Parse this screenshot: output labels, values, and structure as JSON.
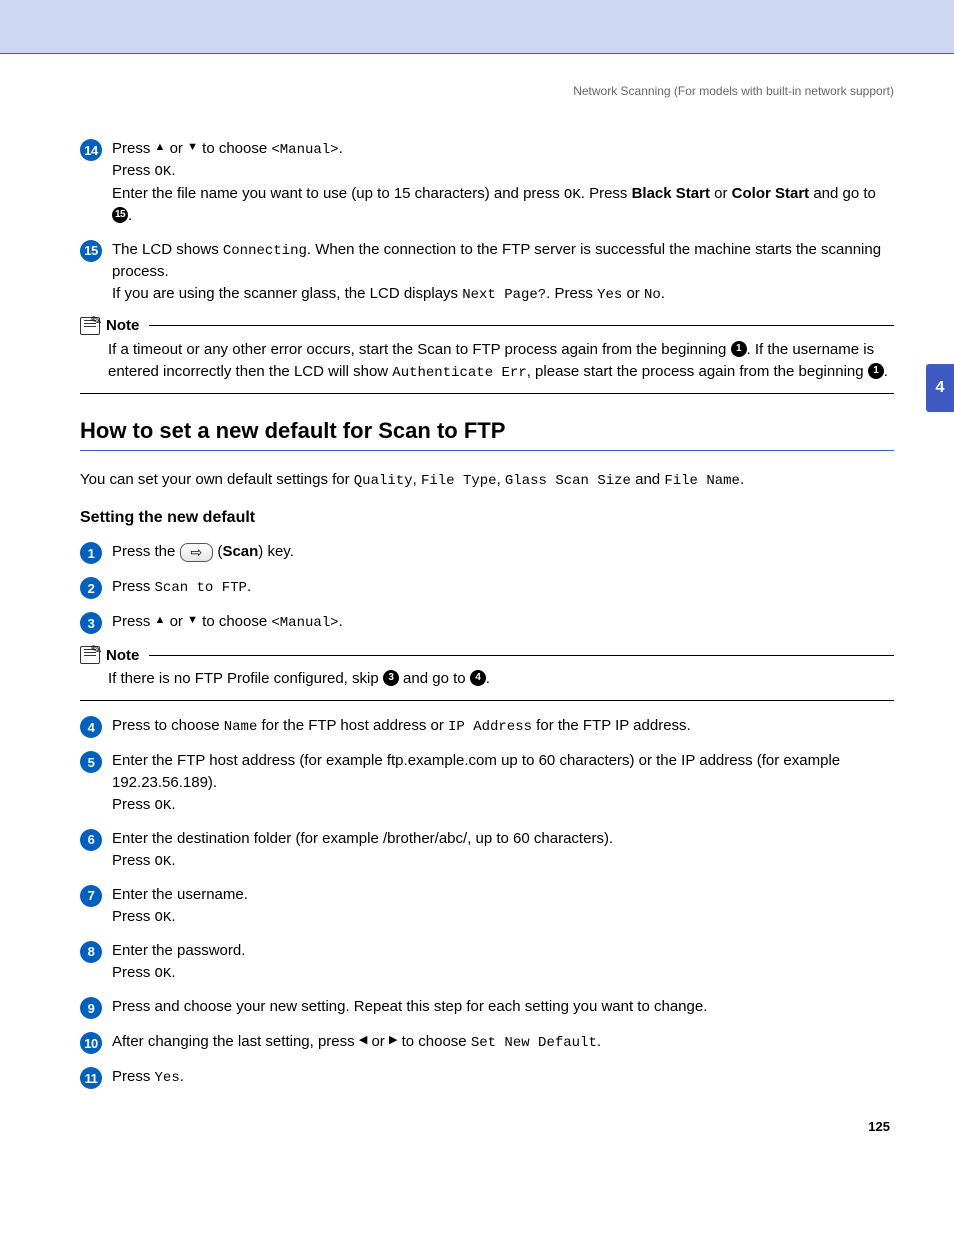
{
  "header": "Network Scanning  (For models with built-in network support)",
  "sideTab": "4",
  "pageNum": "125",
  "step14": {
    "num": "14",
    "l1a": "Press ",
    "l1b": " or ",
    "l1c": " to choose ",
    "l1d": "<Manual>",
    "l1e": ".",
    "l2a": "Press ",
    "l2b": "OK",
    "l2c": ".",
    "l3a": "Enter the file name you want to use (up to 15 characters) and press ",
    "l3b": "OK",
    "l3c": ". Press ",
    "l3d": "Black Start",
    "l3e": " or ",
    "l3f": "Color Start",
    "l3g": " and go to ",
    "l3h": "15",
    "l3i": "."
  },
  "step15": {
    "num": "15",
    "l1a": "The LCD shows ",
    "l1b": "Connecting",
    "l1c": ". When the connection to the FTP server is successful the machine starts the scanning process.",
    "l2a": "If you are using the scanner glass, the LCD displays ",
    "l2b": "Next Page?",
    "l2c": ". Press ",
    "l2d": "Yes",
    "l2e": " or ",
    "l2f": "No",
    "l2g": "."
  },
  "note1": {
    "label": "Note",
    "a": "If a timeout or any other error occurs, start the Scan to FTP process again from the beginning ",
    "b": "1",
    "c": ". If the username is entered incorrectly then the LCD will show ",
    "d": "Authenticate Err",
    "e": ", please start the process again from the beginning ",
    "f": "1",
    "g": "."
  },
  "h2": "How to set a new default for Scan to FTP",
  "intro": {
    "a": "You can set your own default settings for ",
    "b": "Quality",
    "c": ", ",
    "d": "File Type",
    "e": ", ",
    "f": "Glass Scan Size",
    "g": " and ",
    "h": "File Name",
    "i": "."
  },
  "h3": "Setting the new default",
  "s1": {
    "num": "1",
    "a": "Press the ",
    "scan": "⇨",
    "b": " (",
    "c": "Scan",
    "d": ") key."
  },
  "s2": {
    "num": "2",
    "a": "Press ",
    "b": "Scan to FTP",
    "c": "."
  },
  "s3": {
    "num": "3",
    "a": "Press ",
    "b": " or ",
    "c": " to choose ",
    "d": "<Manual>",
    "e": "."
  },
  "note2": {
    "label": "Note",
    "a": "If there is no FTP Profile configured, skip ",
    "b": "3",
    "c": " and go to ",
    "d": "4",
    "e": "."
  },
  "s4": {
    "num": "4",
    "a": "Press to choose ",
    "b": "Name",
    "c": " for the FTP host address or ",
    "d": "IP Address",
    "e": " for the FTP IP address."
  },
  "s5": {
    "num": "5",
    "a": "Enter the FTP host address (for example ftp.example.com up to 60 characters) or the IP address (for example 192.23.56.189).",
    "b": "Press ",
    "c": "OK",
    "d": "."
  },
  "s6": {
    "num": "6",
    "a": "Enter the destination folder (for example /brother/abc/, up to 60 characters).",
    "b": "Press ",
    "c": "OK",
    "d": "."
  },
  "s7": {
    "num": "7",
    "a": "Enter the username.",
    "b": "Press ",
    "c": "OK",
    "d": "."
  },
  "s8": {
    "num": "8",
    "a": "Enter the password.",
    "b": "Press ",
    "c": "OK",
    "d": "."
  },
  "s9": {
    "num": "9",
    "a": "Press and choose your new setting. Repeat this step for each setting you want to change."
  },
  "s10": {
    "num": "10",
    "a": "After changing the last setting, press ",
    "b": " or ",
    "c": " to choose ",
    "d": "Set New Default",
    "e": "."
  },
  "s11": {
    "num": "11",
    "a": "Press ",
    "b": "Yes",
    "c": "."
  }
}
